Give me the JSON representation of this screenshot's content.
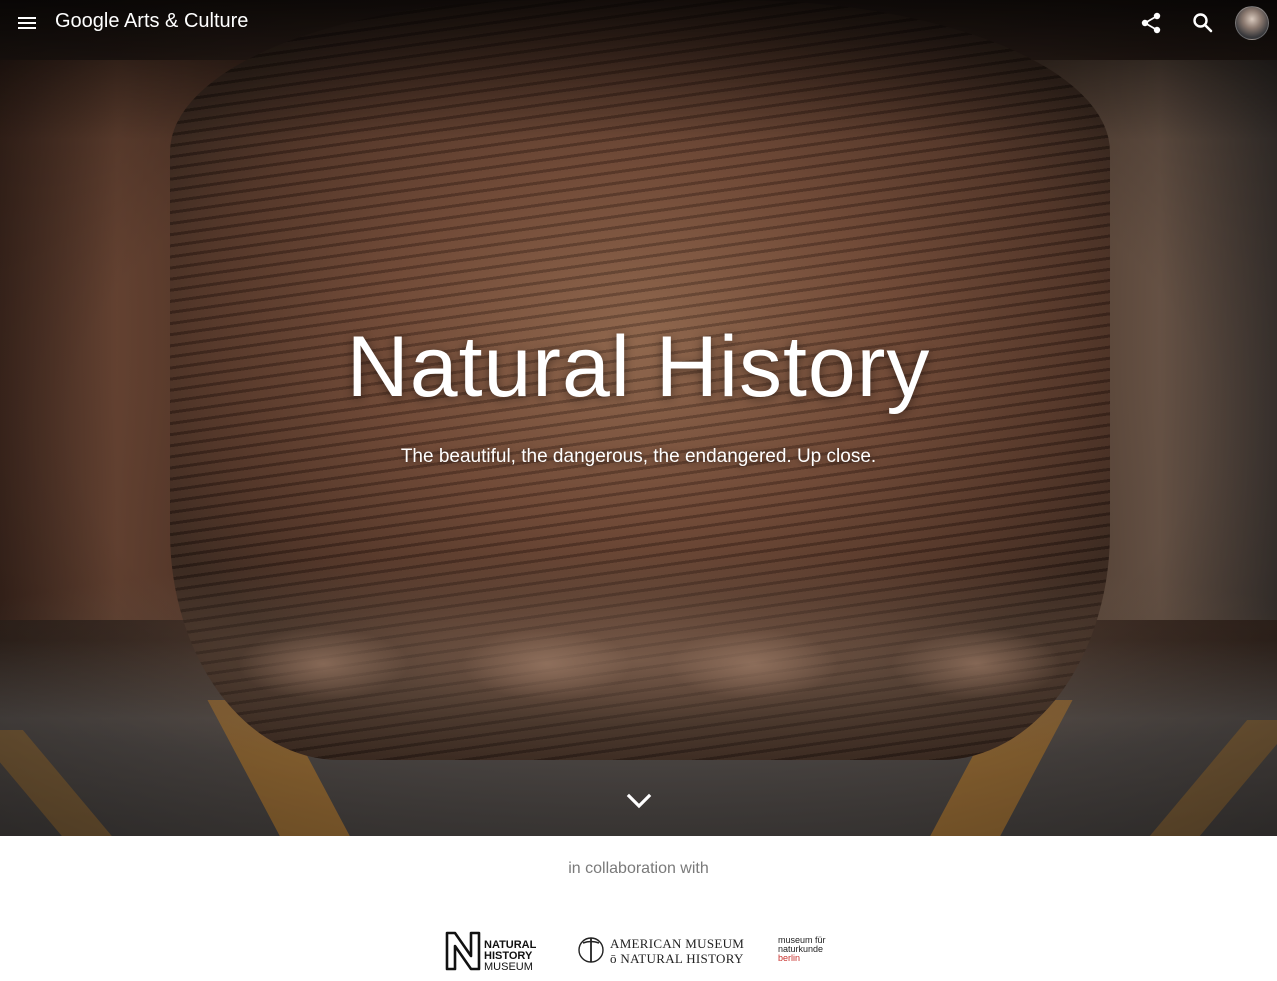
{
  "header": {
    "brand": "Google Arts & Culture",
    "menu_icon": "hamburger-menu-icon",
    "share_icon": "share-icon",
    "search_icon": "search-icon",
    "avatar": "user-avatar"
  },
  "hero": {
    "title": "Natural History",
    "subtitle": "The beautiful, the dangerous, the endangered. Up close.",
    "scroll_icon": "chevron-down-icon"
  },
  "collaboration": {
    "label": "in collaboration with",
    "partners": [
      {
        "name": "Natural History Museum",
        "lines": [
          "NATURAL",
          "HISTORY",
          "MUSEUM"
        ]
      },
      {
        "name": "American Museum of Natural History",
        "lines": [
          "AMERICAN MUSEUM",
          "NATURAL HISTORY"
        ],
        "connector": "ō"
      },
      {
        "name": "museum für naturkunde berlin",
        "lines": [
          "museum für",
          "naturkunde",
          "berlin"
        ]
      }
    ]
  },
  "colors": {
    "hero_text": "#ffffff",
    "collab_text": "#7a7a7a",
    "mfn_accent": "#c8302c"
  }
}
